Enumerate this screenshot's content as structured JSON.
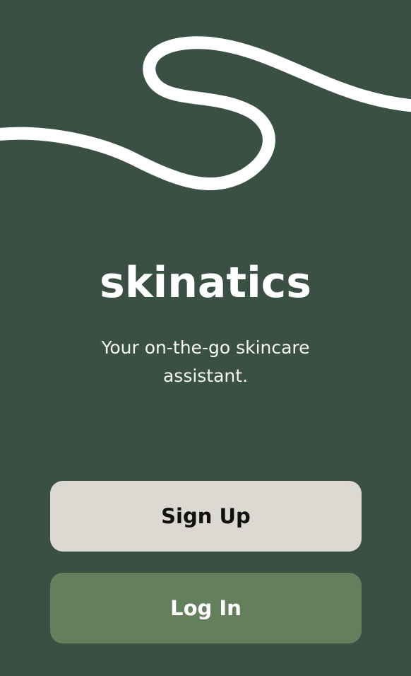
{
  "app": {
    "name": "skinatics",
    "tagline": "Your on-the-go skincare assistant."
  },
  "actions": {
    "signup_label": "Sign Up",
    "login_label": "Log In"
  },
  "colors": {
    "background": "#3b5045",
    "signup_button": "#dbd9d2",
    "login_button": "#637f5c",
    "wave": "#ffffff"
  }
}
